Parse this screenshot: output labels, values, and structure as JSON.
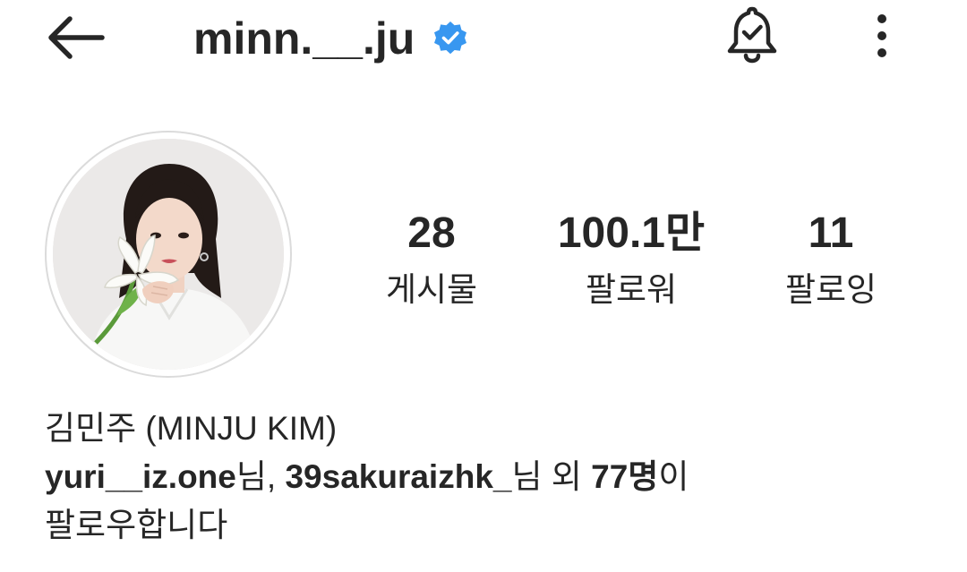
{
  "header": {
    "username": "minn.__.ju",
    "verified": true,
    "icons": {
      "back": "arrow-left-icon",
      "verified": "verified-badge-icon",
      "bell": "bell-check-icon",
      "more": "more-vertical-icon"
    }
  },
  "colors": {
    "text": "#262626",
    "verified_blue": "#3897f0",
    "ring": "#dbdbdb"
  },
  "stats": [
    {
      "value": "28",
      "label": "게시물"
    },
    {
      "value": "100.1만",
      "label": "팔로워"
    },
    {
      "value": "11",
      "label": "팔로잉"
    }
  ],
  "bio": {
    "name": "김민주 (MINJU KIM)",
    "followed_by": {
      "user1": "yuri__iz.one",
      "suffix1": "님, ",
      "user2": "39sakuraizhk_",
      "suffix2": "님 외 ",
      "count": "77명",
      "suffix3": "이",
      "line2": "팔로우합니다"
    }
  }
}
